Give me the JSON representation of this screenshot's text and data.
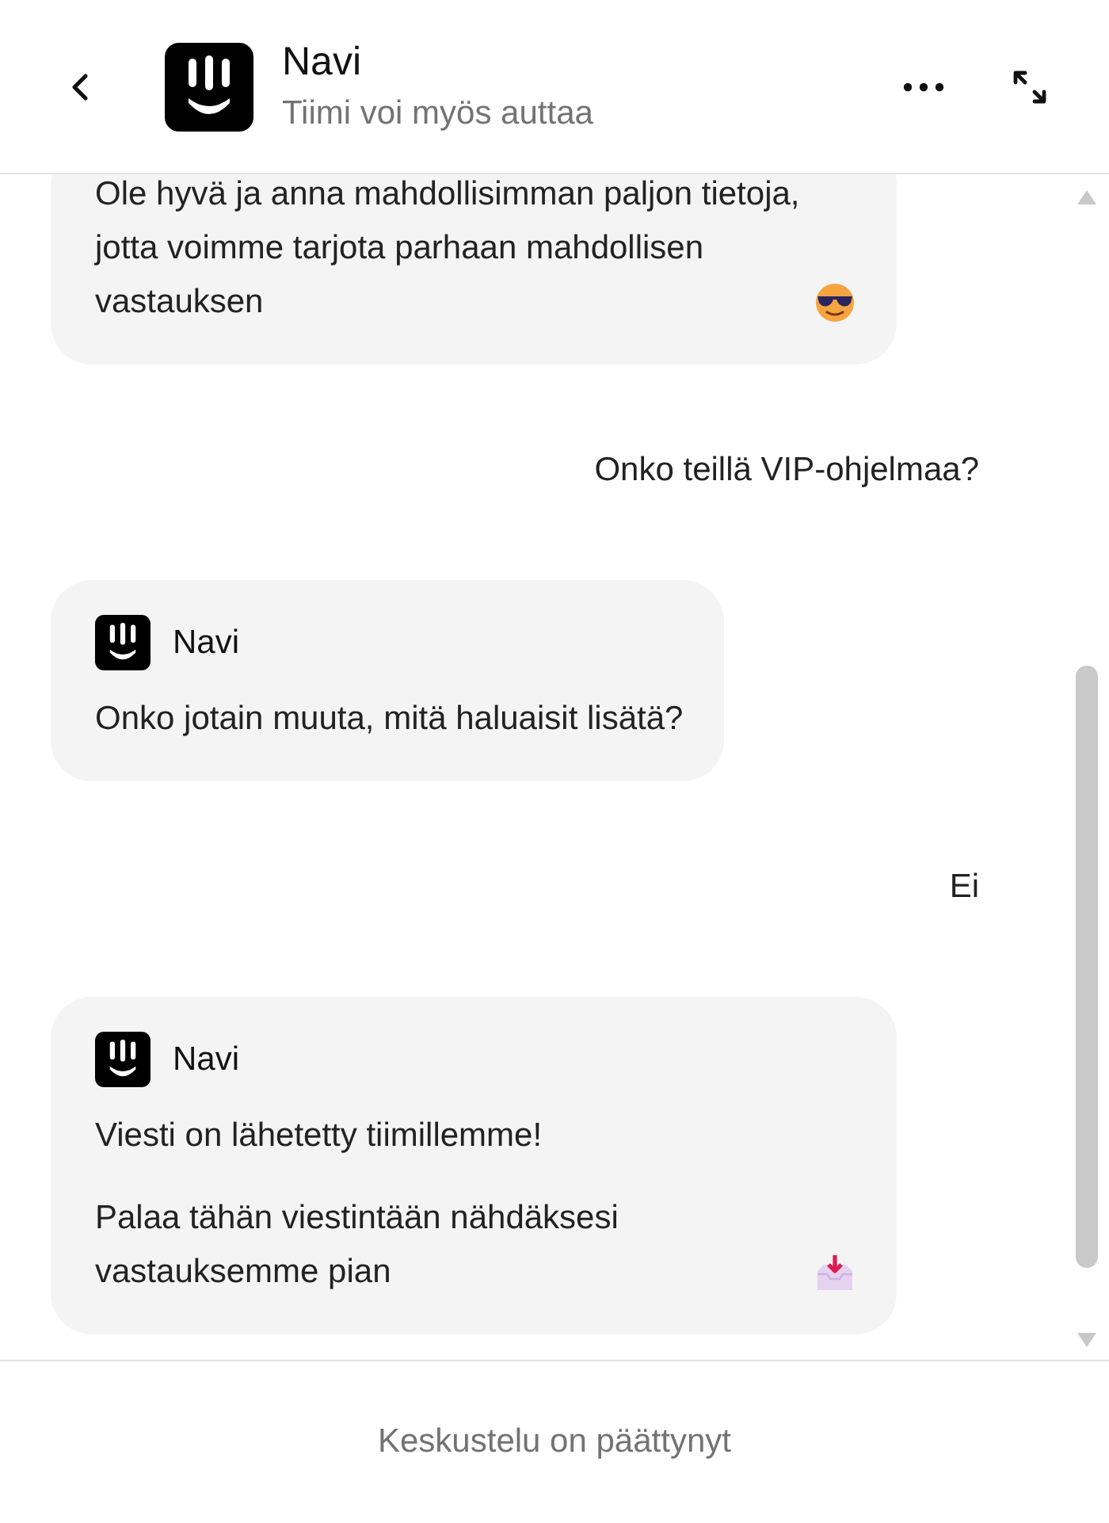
{
  "header": {
    "title": "Navi",
    "subtitle": "Tiimi voi myös auttaa"
  },
  "messages": [
    {
      "kind": "bot",
      "paragraphs": [
        {
          "text": "Ole hyvä ja anna mahdollisimman paljon tietoja, jotta voimme tarjota parhaan mahdollisen vastauksen"
        }
      ]
    },
    {
      "kind": "user",
      "text": "Onko teillä VIP-ohjelmaa?"
    },
    {
      "kind": "bot",
      "author": "Navi",
      "paragraphs": [
        {
          "text": "Onko jotain muuta, mitä haluaisit lisätä?"
        }
      ]
    },
    {
      "kind": "user",
      "text": "Ei"
    },
    {
      "kind": "bot",
      "author": "Navi",
      "paragraphs": [
        {
          "text": "Viesti on lähetetty tiimillemme!"
        },
        {
          "text": "Palaa tähän viestintään nähdäksesi vastauksemme pian"
        }
      ]
    }
  ],
  "footer": {
    "status": "Keskustelu on päättynyt"
  }
}
